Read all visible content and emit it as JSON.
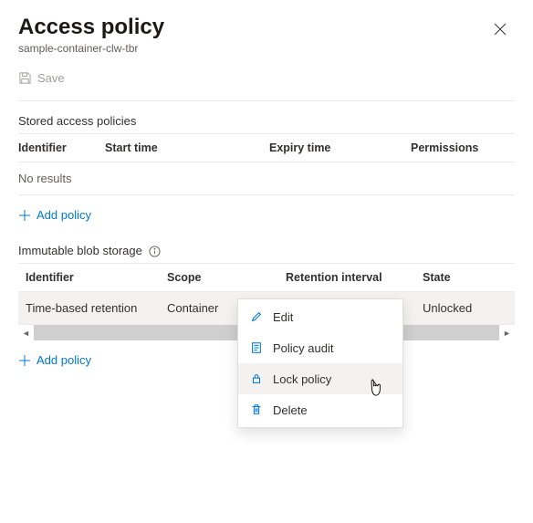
{
  "header": {
    "title": "Access policy",
    "subtitle": "sample-container-clw-tbr"
  },
  "toolbar": {
    "save_label": "Save"
  },
  "sap": {
    "section_title": "Stored access policies",
    "columns": {
      "identifier": "Identifier",
      "start_time": "Start time",
      "expiry_time": "Expiry time",
      "permissions": "Permissions"
    },
    "no_results": "No results",
    "add_label": "Add policy"
  },
  "ibs": {
    "section_title": "Immutable blob storage",
    "columns": {
      "identifier": "Identifier",
      "scope": "Scope",
      "retention": "Retention interval",
      "state": "State"
    },
    "row": {
      "identifier": "Time-based retention",
      "scope": "Container",
      "retention": "",
      "state": "Unlocked"
    },
    "add_label": "Add policy"
  },
  "ctx": {
    "edit": "Edit",
    "audit": "Policy audit",
    "lock": "Lock policy",
    "delete": "Delete"
  }
}
